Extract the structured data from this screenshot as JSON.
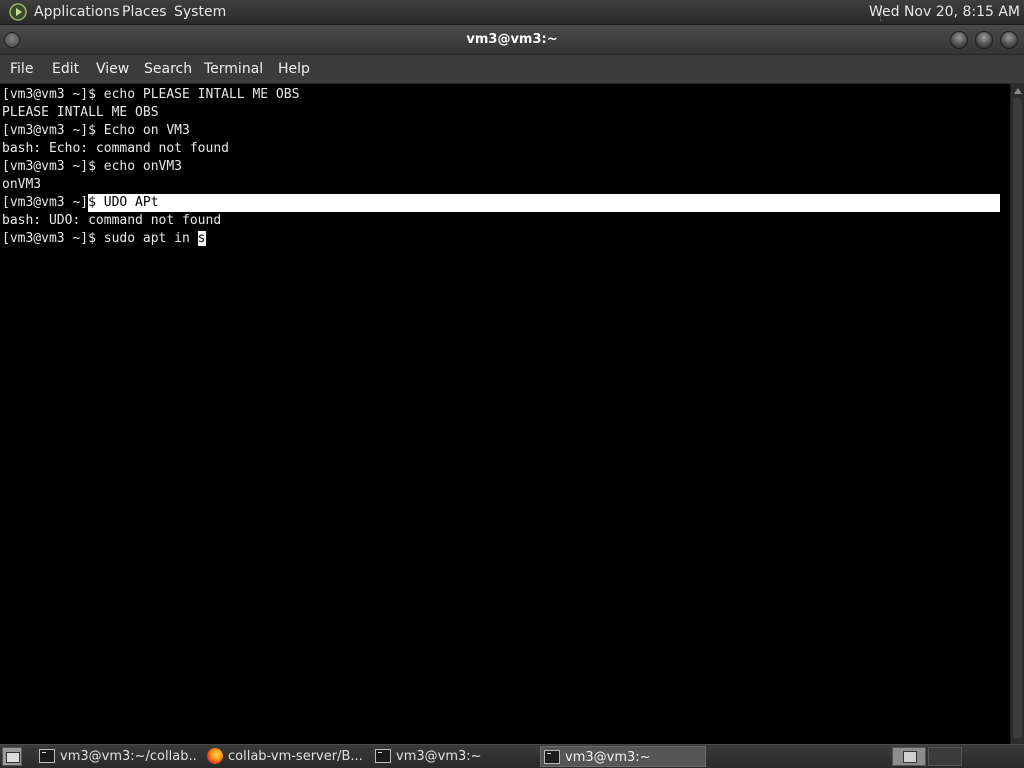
{
  "top_panel": {
    "menus": [
      "Applications",
      "Places",
      "System"
    ],
    "clock": "Wed Nov 20,  8:15 AM"
  },
  "window": {
    "title": "vm3@vm3:~"
  },
  "menubar": {
    "items": [
      "File",
      "Edit",
      "View",
      "Search",
      "Terminal",
      "Help"
    ]
  },
  "terminal": {
    "lines": [
      "[vm3@vm3 ~]$ echo PLEASE INTALL ME OBS",
      "PLEASE INTALL ME OBS",
      "[vm3@vm3 ~]$ Echo on VM3",
      "bash: Echo: command not found",
      "[vm3@vm3 ~]$ echo onVM3",
      "onVM3"
    ],
    "selected_line": {
      "prefix": "[vm3@vm3 ~]",
      "selected_text": "$ UDO APt"
    },
    "after_lines": [
      "bash: UDO: command not found"
    ],
    "current_prompt": "[vm3@vm3 ~]$ sudo apt in ",
    "cursor_char": "s"
  },
  "taskbar": {
    "tasks": [
      {
        "label": "vm3@vm3:~/collab...",
        "icon": "terminal-icon",
        "active": false
      },
      {
        "label": "collab-vm-server/B...",
        "icon": "firefox-icon",
        "active": false
      },
      {
        "label": "vm3@vm3:~",
        "icon": "terminal-icon",
        "active": false
      },
      {
        "label": "vm3@vm3:~",
        "icon": "terminal-icon",
        "active": true
      }
    ]
  }
}
